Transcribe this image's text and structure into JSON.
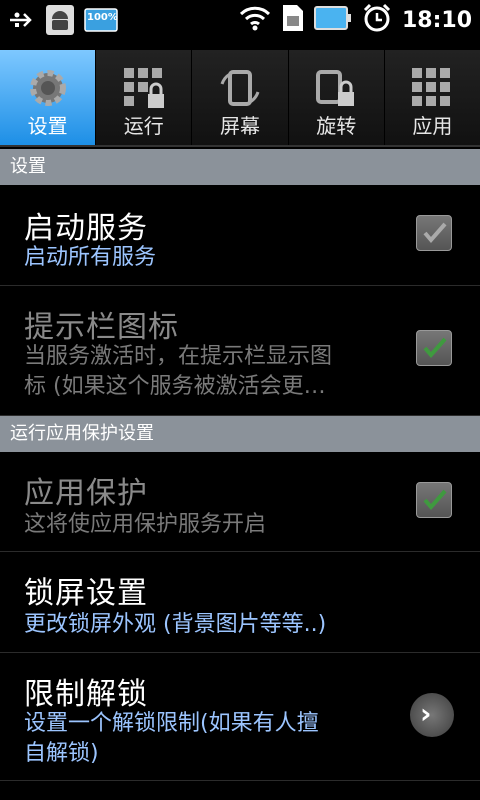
{
  "status_bar": {
    "time": "18:10",
    "battery_badge": "100%",
    "icons": [
      "usb-icon",
      "android-debug-icon",
      "battery-badge-icon",
      "wifi-icon",
      "sim-icon",
      "battery-icon",
      "alarm-icon"
    ]
  },
  "tabs": [
    {
      "label": "设置",
      "icon": "gear-icon",
      "active": true
    },
    {
      "label": "运行",
      "icon": "lock-grid-icon"
    },
    {
      "label": "屏幕",
      "icon": "screen-rotate-icon"
    },
    {
      "label": "旋转",
      "icon": "rotate-lock-icon"
    },
    {
      "label": "应用",
      "icon": "apps-grid-icon"
    }
  ],
  "sections": [
    {
      "title": "设置"
    },
    {
      "title": "运行应用保护设置"
    }
  ],
  "items": [
    {
      "title": "启动服务",
      "summary": "启动所有服务",
      "control": "checkbox",
      "checked": true,
      "enabled": true
    },
    {
      "title": "提示栏图标",
      "summary_line1": "当服务激活时，在提示栏显示图",
      "summary_line2": "标 (如果这个服务被激活会更…",
      "control": "checkbox",
      "checked": true,
      "enabled": false
    },
    {
      "title": "应用保护",
      "summary": "这将使应用保护服务开启",
      "control": "checkbox",
      "checked": true,
      "enabled": false
    },
    {
      "title": "锁屏设置",
      "summary": "更改锁屏外观 (背景图片等等..)",
      "enabled": true
    },
    {
      "title": "限制解锁",
      "summary_line1": "设置一个解锁限制(如果有人擅",
      "summary_line2": "自解锁)",
      "control": "arrow",
      "enabled": true
    }
  ],
  "colors": {
    "accent": "#1d8fe6",
    "summary_text": "#9cc5ff",
    "section_header": "#8b929a"
  }
}
